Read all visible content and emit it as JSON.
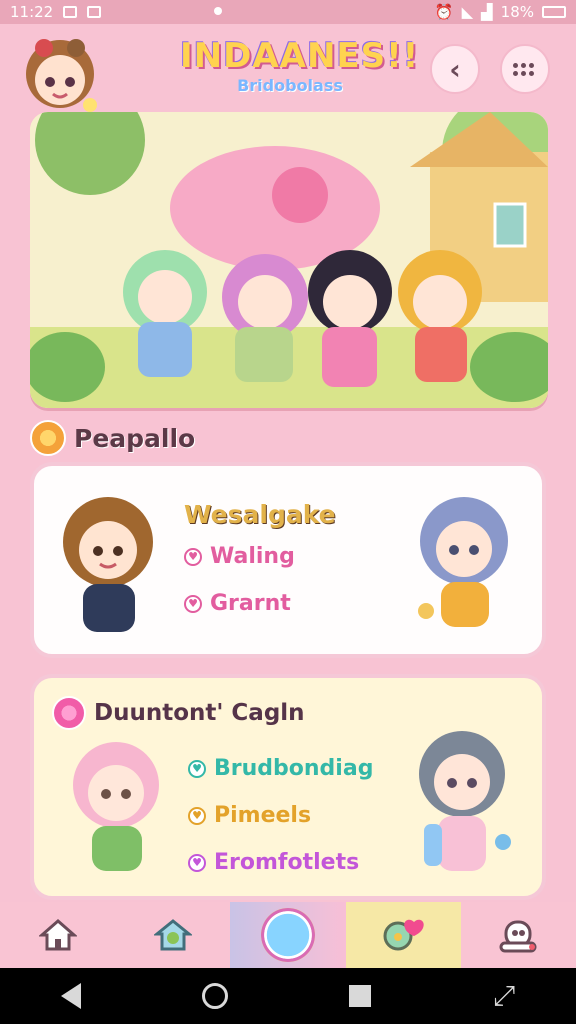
{
  "status": {
    "time": "11:22",
    "battery": "18%"
  },
  "header": {
    "logo_title": "INDAANES!!",
    "logo_subtitle": "Bridobolass",
    "back_icon": "chevron-left-icon",
    "menu_icon": "grid-dots-icon"
  },
  "section": {
    "title": "Peapallo"
  },
  "card1": {
    "heading": "Wesalgake",
    "items": [
      {
        "label": "Waling",
        "icon": "heart-icon",
        "color": "#e25d9f"
      },
      {
        "label": "Grarnt",
        "icon": "heart-icon",
        "color": "#e25d9f"
      }
    ]
  },
  "card2": {
    "heading": "Duuntont' Cagln",
    "items": [
      {
        "label": "Brudbondiag",
        "icon": "heart-icon",
        "color": "#34b8a8"
      },
      {
        "label": "Pimeels",
        "icon": "heart-icon",
        "color": "#e3a22a"
      },
      {
        "label": "Eromfotlets",
        "icon": "heart-icon",
        "color": "#c356d9"
      }
    ]
  },
  "nav": {
    "items": [
      {
        "icon": "home-icon"
      },
      {
        "icon": "house-plant-icon"
      },
      {
        "icon": "circle-center-icon"
      },
      {
        "icon": "heart-chat-icon"
      },
      {
        "icon": "robot-icon"
      }
    ]
  }
}
